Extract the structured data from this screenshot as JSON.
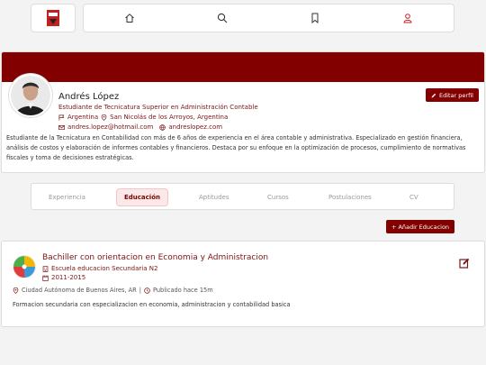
{
  "colors": {
    "brand": "#820000",
    "brand_light": "#fbe8e8",
    "page_bg": "#f3f3f4"
  },
  "nav": {
    "items": [
      {
        "icon": "home-icon"
      },
      {
        "icon": "search-icon"
      },
      {
        "icon": "bookmark-icon"
      },
      {
        "icon": "user-icon"
      }
    ]
  },
  "profile": {
    "name": "Andrés López",
    "title": "Estudiante de Tecnicatura Superior en Administración Contable",
    "country": "Argentina",
    "city": "San Nicolás de los Arroyos, Argentina",
    "email": "andres.lopez@hotmail.com",
    "website": "andreslopez.com",
    "edit_label": "Editar perfil",
    "bio": "Estudiante de la Tecnicatura en Contabilidad con más de 6 años de experiencia en el área contable y administrativa. Especializado en gestión financiera, análisis de costos y elaboración de informes contables y financieros. Destaca por su enfoque en la optimización de procesos, cumplimiento de normativas fiscales y toma de decisiones estratégicas."
  },
  "tabs": [
    {
      "label": "Experiencia",
      "active": false
    },
    {
      "label": "Educación",
      "active": true
    },
    {
      "label": "Aptitudes",
      "active": false
    },
    {
      "label": "Cursos",
      "active": false
    },
    {
      "label": "Postulaciones",
      "active": false
    },
    {
      "label": "CV",
      "active": false
    }
  ],
  "add_button": "+ Añadir Educacion",
  "education": {
    "title": "Bachiller con orientacion en Economia y Administracion",
    "school": "Escuela educacion Secundaria N2",
    "period": "2011-2015",
    "location": "Ciudad Autónoma de Buenos Aires, AR",
    "separator": "|",
    "published": "Publicado hace 15m",
    "description": "Formacion secundaria con especializacion en economia, administracion y contabilidad basica"
  }
}
